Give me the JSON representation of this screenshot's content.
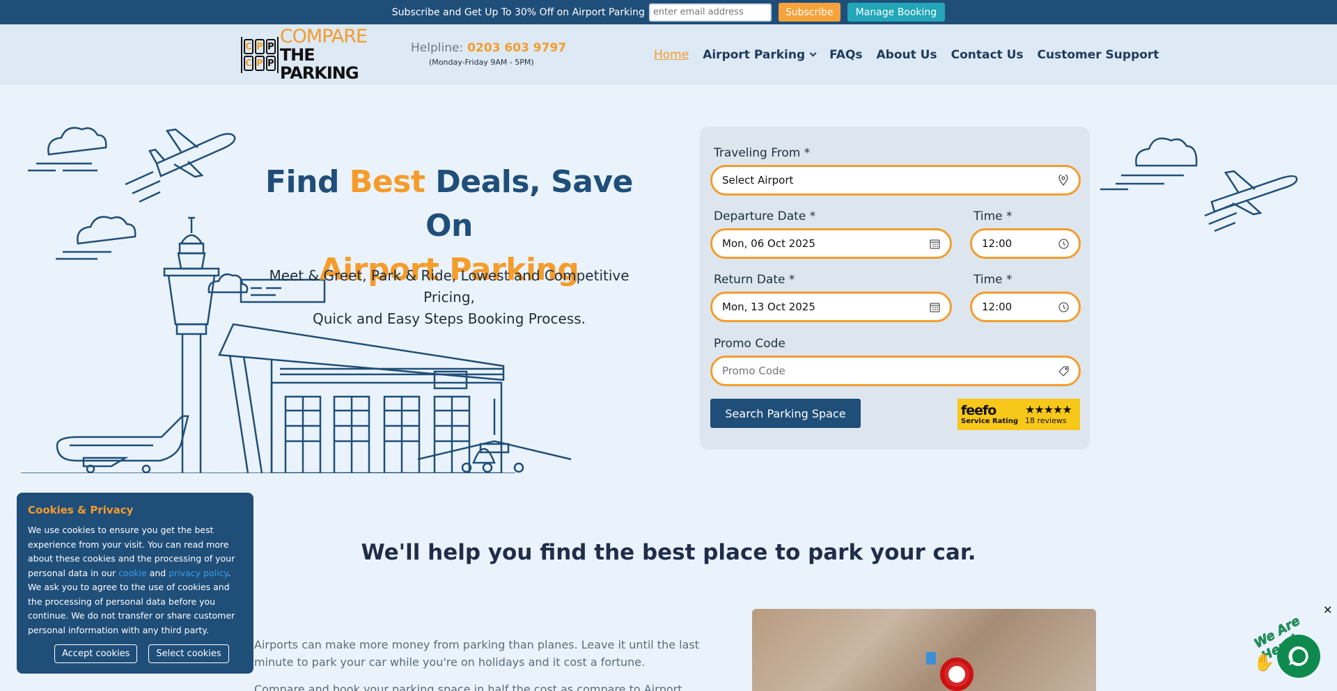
{
  "promo": {
    "text": "Subscribe and Get Up To 30% Off on Airport Parking",
    "email_placeholder": "enter email address",
    "subscribe_label": "Subscribe",
    "manage_label": "Manage Booking"
  },
  "header": {
    "logo_line1": "COMPARE",
    "logo_line2": "THE PARKING",
    "logo_cells": [
      "C",
      "P",
      "P",
      "C",
      "P",
      "P"
    ],
    "helpline_label": "Helpline:",
    "helpline_number": "0203 603 9797",
    "helpline_hours": "(Monday-Friday 9AM - 5PM)",
    "nav": [
      {
        "label": "Home",
        "active": true
      },
      {
        "label": "Airport Parking",
        "dropdown": true
      },
      {
        "label": "FAQs"
      },
      {
        "label": "About Us"
      },
      {
        "label": "Contact Us"
      },
      {
        "label": "Customer Support"
      }
    ]
  },
  "hero": {
    "title_part1": "Find ",
    "title_part2": "Best",
    "title_part3": " Deals, Save On",
    "title_line2": "Airport Parking",
    "subtitle_line1": "Meet & Greet, Park & Ride, Lowest and Competitive Pricing,",
    "subtitle_line2": "Quick and Easy Steps Booking Process."
  },
  "form": {
    "traveling_from_label": "Traveling From *",
    "traveling_from_value": "Select Airport",
    "departure_label": "Departure Date *",
    "departure_value": "Mon, 06 Oct 2025",
    "departure_time_label": "Time *",
    "departure_time_value": "12:00",
    "return_label": "Return Date *",
    "return_value": "Mon, 13 Oct 2025",
    "return_time_label": "Time *",
    "return_time_value": "12:00",
    "promo_label": "Promo Code",
    "promo_placeholder": "Promo Code",
    "search_label": "Search Parking Space"
  },
  "feefo": {
    "logo": "feefo",
    "service": "Service Rating",
    "stars": "★★★★★",
    "reviews": "18 reviews"
  },
  "section": {
    "title": "We'll help you find the best place to park your car.",
    "para1": "Airports can make more money from parking than planes. Leave it until the last minute to park your car while you're on holidays and it cost a fortune.",
    "para2": "Compare and book your parking space in half the cost as compare to Airport parking in"
  },
  "cookie": {
    "title": "Cookies & Privacy",
    "body_1": "We use cookies to ensure you get the best experience from your visit. You can read more about these cookies and the processing of your personal data in our ",
    "link_cookie": "cookie",
    "and": " and ",
    "link_privacy": "privacy policy",
    "body_2": ". We ask you to agree to the use of cookies and the processing of personal data before you continue. We do not transfer or share customer personal information with any third party.",
    "accept_label": "Accept cookies",
    "select_label": "Select cookies"
  },
  "chat": {
    "tagline": "We Are Here!",
    "close": "✕"
  },
  "colors": {
    "primary": "#1f4e79",
    "accent": "#f49c2c",
    "teal": "#22a6b8",
    "feefo_yellow": "#f7c719",
    "chat_green": "#0f8a4f"
  }
}
